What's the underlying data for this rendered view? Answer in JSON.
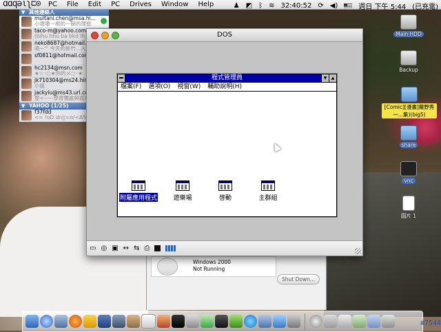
{
  "menubar": {
    "logo": "ɑɑqǝιʅ⊏⊙",
    "menus": [
      "PC",
      "File",
      "Edit",
      "PC",
      "Drives",
      "Window",
      "Help"
    ],
    "clock_text": "32:40:52",
    "day_time": "週日 下午 5:44",
    "input_method": "(已充電)"
  },
  "buddy_list": {
    "group1": "其他連絡人",
    "contacts": [
      {
        "name": "multani.chen@msa.hi...",
        "status": "小壞壞一根的一碗的理慾"
      },
      {
        "name": "taco-m@yahoo.com...",
        "status": "(bihu hhu ba bkd lh"
      },
      {
        "name": "neko8687@hotmail.c...",
        "status": "唔~^ 今天的新竹...入山入"
      },
      {
        "name": "sf0811@hotmail.com",
        "status": ""
      },
      {
        "name": "hc2134@msn.com",
        "status": "★☆･○★你的メ○･★"
      },
      {
        "name": "jk710304@ms24.hin...",
        "status": "小姐"
      },
      {
        "name": "jackylu@ms43.url.co...",
        "status": "愛<-----學習獨處與孤單"
      }
    ],
    "group2": "YAHOO (1/25)",
    "yahoo": [
      {
        "name": "f37fdd",
        "status": "<= !oD dn||=o/<A%R="
      }
    ]
  },
  "dos_window": {
    "title": "DOS",
    "program_manager": {
      "title": "程式管理員",
      "menu": [
        "檔案(F)",
        "選項(O)",
        "視窗(W)",
        "輔助說明(H)"
      ],
      "groups": [
        {
          "label": "附屬應用程式",
          "selected": true
        },
        {
          "label": "遊樂場",
          "selected": false
        },
        {
          "label": "啓動",
          "selected": false
        },
        {
          "label": "主群組",
          "selected": false
        }
      ]
    }
  },
  "vm_window": {
    "vm_name": "Windows 2000",
    "vm_status": "Not Running",
    "shutdown_label": "Shut Down..."
  },
  "desktop_icons": [
    {
      "label": "Main HDD",
      "kind": "hdd"
    },
    {
      "label": "Backup",
      "kind": "hdd"
    },
    {
      "label": "[Comic][漫畫]蘿野秀一...集)(big5)",
      "kind": "folder"
    },
    {
      "label": "share",
      "kind": "folder"
    },
    {
      "label": "vnc",
      "kind": "vnc"
    },
    {
      "label": "圖片 1",
      "kind": "doc"
    }
  ],
  "watermark": "#7544",
  "colors": {
    "win31_title": "#0000a8",
    "selection": "#0000a8",
    "folder_highlight": "#f4e34a"
  }
}
